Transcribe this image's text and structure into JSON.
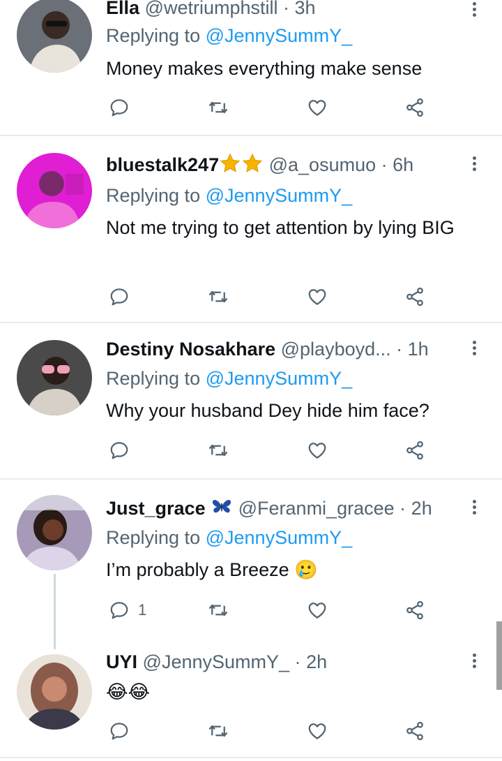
{
  "reply_prefix": "Replying to",
  "tweets": [
    {
      "name": "Ella",
      "handle": "@wetriumphstill",
      "dot": "·",
      "time": "3h",
      "replying_to": "@JennySummY_",
      "text": "Money makes everything make sense",
      "reply_count": "",
      "avatar_color": "#6b6f77"
    },
    {
      "name": "bluestalk247",
      "handle": "@a_osumuo",
      "dot": "·",
      "time": "6h",
      "replying_to": "@JennySummY_",
      "text": "Not me trying to get attention by lying BIG",
      "reply_count": "",
      "avatar_color": "#e01ed4",
      "name_emoji": "star-star"
    },
    {
      "name": "Destiny Nosakhare",
      "handle": "@playboyd...",
      "dot": "·",
      "time": "1h",
      "replying_to": "@JennySummY_",
      "text": "Why your husband Dey hide him face?",
      "reply_count": "",
      "avatar_color": "#4a4a4a"
    },
    {
      "name": "Just_grace",
      "handle": "@Feranmi_gracee",
      "dot": "·",
      "time": "2h",
      "replying_to": "@JennySummY_",
      "text": "I’m probably a Breeze 🥲",
      "reply_count": "1",
      "avatar_color": "#a69ab8",
      "name_emoji": "butterfly"
    },
    {
      "name": "UYI",
      "handle": "@JennySummY_",
      "dot": "·",
      "time": "2h",
      "replying_to": "",
      "text": "😂😂",
      "reply_count": "",
      "avatar_color": "#8a5a4a"
    }
  ],
  "colors": {
    "text": "#0f1419",
    "secondary": "#536471",
    "link": "#1d9bf0",
    "divider": "#e6ecf0"
  },
  "icons": [
    "reply-icon",
    "retweet-icon",
    "like-icon",
    "share-icon",
    "more-icon"
  ]
}
